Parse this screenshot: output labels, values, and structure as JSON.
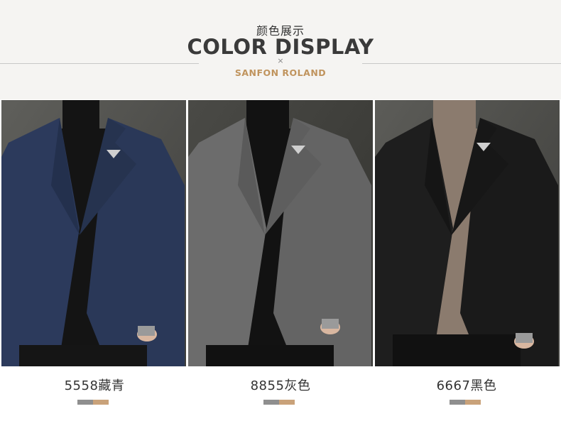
{
  "header": {
    "cn_title": "颜色展示",
    "en_title": "COLOR DISPLAY",
    "separator": "×",
    "brand": "SANFON ROLAND"
  },
  "colors": {
    "header_bg": "#f5f4f2",
    "brand": "#c0945e",
    "swatch_gray": "#8f8f8f",
    "swatch_tan": "#c9a27a"
  },
  "products": [
    {
      "label": "5558藏青",
      "jacket_color": "#2b3a5c",
      "sweater_color": "#151515"
    },
    {
      "label": "8855灰色",
      "jacket_color": "#6a6a6a",
      "sweater_color": "#121212"
    },
    {
      "label": "6667黑色",
      "jacket_color": "#1d1d1d",
      "sweater_color": "#8a7a6d"
    }
  ]
}
